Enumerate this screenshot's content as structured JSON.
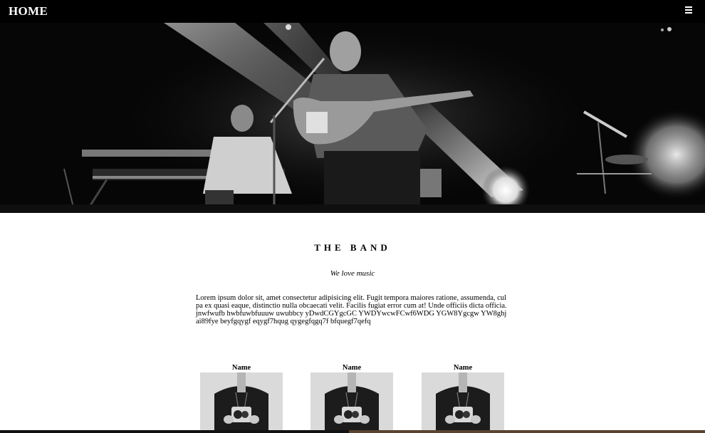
{
  "nav": {
    "home_label": "HOME",
    "menu_icon": "hamburger-menu-icon"
  },
  "hero": {
    "image": "band-performing-on-stage-photo"
  },
  "band": {
    "title": "THE BAND",
    "subtitle": "We love music",
    "description": "Lorem ipsum dolor sit, amet consectetur adipisicing elit. Fugit tempora maiores ratione, assumenda, culpa ex quasi eaque, distinctio nulla obcaecati velit. Facilis fugiat error cum at! Unde officiis dicta officia. jnwfwufb hwbfuwbfuuuw uwubbcy yDwdCGYgcGC YWDYwcwFCwf6WDG YGW8Ygcgw YW8ghjai89fye beyfgqygf eqygf7hqug qygegfqgq7f bfquegf7qefq"
  },
  "members": [
    {
      "name": "Name",
      "photo": "person-holding-camera-photo"
    },
    {
      "name": "Name",
      "photo": "person-holding-camera-photo"
    },
    {
      "name": "Name",
      "photo": "person-holding-camera-photo"
    }
  ]
}
